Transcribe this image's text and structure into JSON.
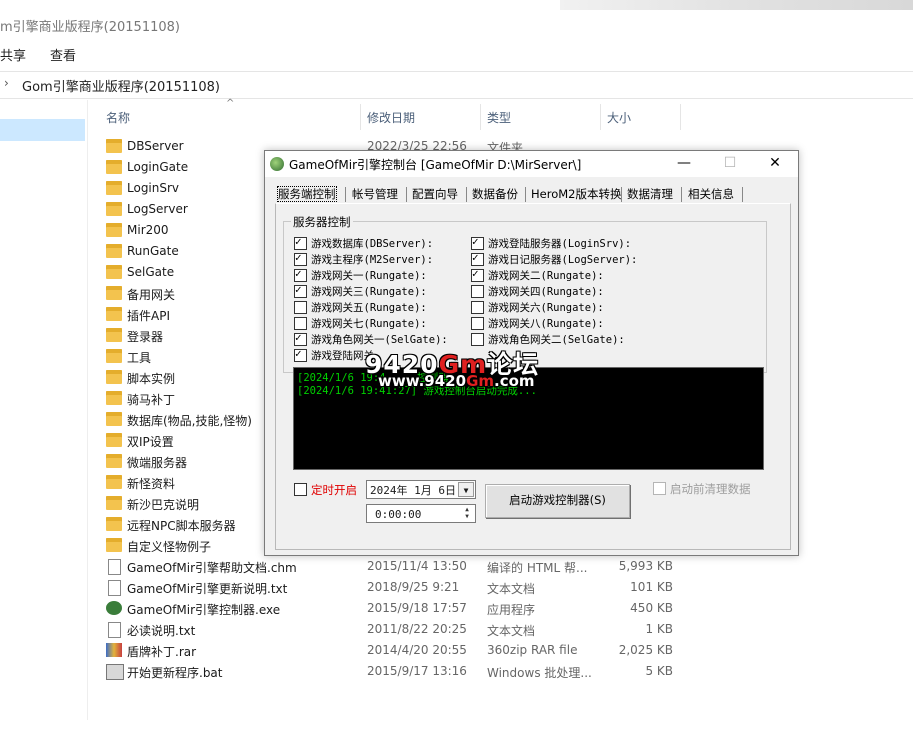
{
  "explorer": {
    "window_title": "m引擎商业版程序(20151108)",
    "menu": [
      "共享",
      "查看"
    ],
    "address_path": "Gom引擎商业版程序(20151108)",
    "columns": {
      "name": "名称",
      "modified": "修改日期",
      "type": "类型",
      "size": "大小"
    },
    "rows": [
      {
        "icon": "folder-icon",
        "name": "DBServer",
        "modified": "2022/3/25 22:56",
        "type": "文件夹",
        "size": ""
      },
      {
        "icon": "folder-icon",
        "name": "LoginGate",
        "modified": "",
        "type": "",
        "size": ""
      },
      {
        "icon": "folder-icon",
        "name": "LoginSrv",
        "modified": "",
        "type": "",
        "size": ""
      },
      {
        "icon": "folder-icon",
        "name": "LogServer",
        "modified": "",
        "type": "",
        "size": ""
      },
      {
        "icon": "folder-icon",
        "name": "Mir200",
        "modified": "",
        "type": "",
        "size": ""
      },
      {
        "icon": "folder-icon",
        "name": "RunGate",
        "modified": "",
        "type": "",
        "size": ""
      },
      {
        "icon": "folder-icon",
        "name": "SelGate",
        "modified": "",
        "type": "",
        "size": ""
      },
      {
        "icon": "folder-icon",
        "name": "备用网关",
        "modified": "",
        "type": "",
        "size": ""
      },
      {
        "icon": "folder-icon",
        "name": "插件API",
        "modified": "",
        "type": "",
        "size": ""
      },
      {
        "icon": "folder-icon",
        "name": "登录器",
        "modified": "",
        "type": "",
        "size": ""
      },
      {
        "icon": "folder-icon",
        "name": "工具",
        "modified": "",
        "type": "",
        "size": ""
      },
      {
        "icon": "folder-icon",
        "name": "脚本实例",
        "modified": "",
        "type": "",
        "size": ""
      },
      {
        "icon": "folder-icon",
        "name": "骑马补丁",
        "modified": "",
        "type": "",
        "size": ""
      },
      {
        "icon": "folder-icon",
        "name": "数据库(物品,技能,怪物)",
        "modified": "",
        "type": "",
        "size": ""
      },
      {
        "icon": "folder-icon",
        "name": "双IP设置",
        "modified": "",
        "type": "",
        "size": ""
      },
      {
        "icon": "folder-icon",
        "name": "微端服务器",
        "modified": "",
        "type": "",
        "size": ""
      },
      {
        "icon": "folder-icon",
        "name": "新怪资料",
        "modified": "",
        "type": "",
        "size": ""
      },
      {
        "icon": "folder-icon",
        "name": "新沙巴克说明",
        "modified": "",
        "type": "",
        "size": ""
      },
      {
        "icon": "folder-icon",
        "name": "远程NPC脚本服务器",
        "modified": "",
        "type": "",
        "size": ""
      },
      {
        "icon": "folder-icon",
        "name": "自定义怪物例子",
        "modified": "",
        "type": "",
        "size": ""
      },
      {
        "icon": "chm-file-icon",
        "name": "GameOfMir引擎帮助文档.chm",
        "modified": "2015/11/4 13:50",
        "type": "编译的 HTML 帮...",
        "size": "5,993 KB"
      },
      {
        "icon": "text-file-icon",
        "name": "GameOfMir引擎更新说明.txt",
        "modified": "2018/9/25 9:21",
        "type": "文本文档",
        "size": "101 KB"
      },
      {
        "icon": "exe-file-icon",
        "name": "GameOfMir引擎控制器.exe",
        "modified": "2015/9/18 17:57",
        "type": "应用程序",
        "size": "450 KB"
      },
      {
        "icon": "text-file-icon",
        "name": "必读说明.txt",
        "modified": "2011/8/22 20:25",
        "type": "文本文档",
        "size": "1 KB"
      },
      {
        "icon": "rar-file-icon",
        "name": "盾牌补丁.rar",
        "modified": "2014/4/20 20:55",
        "type": "360zip RAR file",
        "size": "2,025 KB"
      },
      {
        "icon": "bat-file-icon",
        "name": "开始更新程序.bat",
        "modified": "2015/9/17 13:16",
        "type": "Windows 批处理...",
        "size": "5 KB"
      }
    ]
  },
  "dialog": {
    "title": "GameOfMir引擎控制台 [GameOfMir D:\\MirServer\\]",
    "win_buttons": {
      "minimize": "—",
      "maximize": "☐",
      "close": "✕"
    },
    "tabs": [
      "服务端控制",
      "帐号管理",
      "配置向导",
      "数据备份",
      "HeroM2版本转换",
      "数据清理",
      "相关信息"
    ],
    "active_tab": 0,
    "group_label": "服务器控制",
    "checkboxes": [
      {
        "label": "游戏数据库(DBServer):",
        "checked": true
      },
      {
        "label": "游戏登陆服务器(LoginSrv):",
        "checked": true
      },
      {
        "label": "游戏主程序(M2Server):",
        "checked": true
      },
      {
        "label": "游戏日记服务器(LogServer):",
        "checked": true
      },
      {
        "label": "游戏网关一(Rungate):",
        "checked": true
      },
      {
        "label": "游戏网关二(Rungate):",
        "checked": true
      },
      {
        "label": "游戏网关三(Rungate):",
        "checked": true
      },
      {
        "label": "游戏网关四(Rungate):",
        "checked": false
      },
      {
        "label": "游戏网关五(Rungate):",
        "checked": false
      },
      {
        "label": "游戏网关六(Rungate):",
        "checked": false
      },
      {
        "label": "游戏网关七(Rungate):",
        "checked": false
      },
      {
        "label": "游戏网关八(Rungate):",
        "checked": false
      },
      {
        "label": "游戏角色网关一(SelGate):",
        "checked": true
      },
      {
        "label": "游戏角色网关二(SelGate):",
        "checked": false
      },
      {
        "label": "游戏登陆网关",
        "checked": true
      }
    ],
    "console_lines": [
      "[2024/1/6 19:4 ... 控制器...",
      "[2024/1/6 19:41:27] 游戏控制台启动完成..."
    ],
    "watermark_line1_a": "9420",
    "watermark_line1_red": "Gm",
    "watermark_line1_b": "论坛",
    "watermark_line2_a": "www.9420",
    "watermark_line2_red": "Gm",
    "watermark_line2_b": ".com",
    "timer_label": "定时开启",
    "timer_checked": false,
    "date_value": "2024年 1月 6日",
    "time_value": "0:00:00",
    "start_button": "启动游戏控制器(S)",
    "clean_label": "启动前清理数据",
    "clean_checked": false
  }
}
